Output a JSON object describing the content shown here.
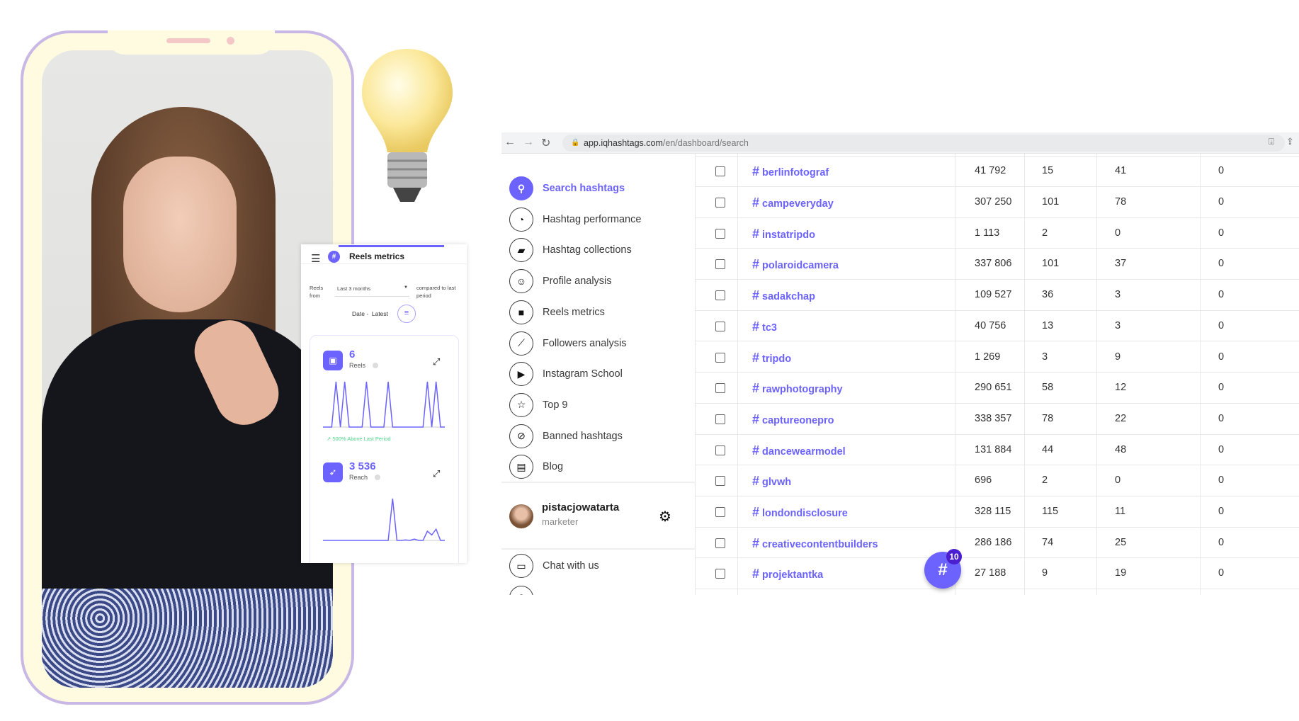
{
  "colors": {
    "accent": "#6c63ff",
    "positive": "#4cd38a",
    "phone_frame": "#c9b8e6"
  },
  "browser": {
    "url_host": "app.iqhashtags.com",
    "url_path": "/en/dashboard/search",
    "icons": [
      "back-arrow-icon",
      "forward-arrow-icon",
      "reload-icon",
      "lock-icon",
      "install-icon",
      "share-icon"
    ]
  },
  "sidebar": {
    "items": [
      {
        "label": "Search hashtags",
        "icon": "search-icon",
        "active": true
      },
      {
        "label": "Hashtag performance",
        "icon": "gauge-icon"
      },
      {
        "label": "Hashtag collections",
        "icon": "folder-star-icon"
      },
      {
        "label": "Profile analysis",
        "icon": "face-icon"
      },
      {
        "label": "Reels metrics",
        "icon": "video-camera-icon"
      },
      {
        "label": "Followers analysis",
        "icon": "trend-icon"
      },
      {
        "label": "Instagram School",
        "icon": "play-chat-icon"
      },
      {
        "label": "Top 9",
        "icon": "star-icon"
      },
      {
        "label": "Banned hashtags",
        "icon": "ban-icon"
      },
      {
        "label": "Blog",
        "icon": "document-icon"
      }
    ],
    "user": {
      "name": "pistacjowatarta",
      "role": "marketer"
    },
    "chat_label": "Chat with us"
  },
  "table": {
    "rows": [
      {
        "tag": "berlinfotograf",
        "c1": "41 792",
        "c2": "15",
        "c3": "41",
        "c4": "0"
      },
      {
        "tag": "campeveryday",
        "c1": "307 250",
        "c2": "101",
        "c3": "78",
        "c4": "0"
      },
      {
        "tag": "instatripdo",
        "c1": "1 113",
        "c2": "2",
        "c3": "0",
        "c4": "0"
      },
      {
        "tag": "polaroidcamera",
        "c1": "337 806",
        "c2": "101",
        "c3": "37",
        "c4": "0"
      },
      {
        "tag": "sadakchap",
        "c1": "109 527",
        "c2": "36",
        "c3": "3",
        "c4": "0"
      },
      {
        "tag": "tc3",
        "c1": "40 756",
        "c2": "13",
        "c3": "3",
        "c4": "0"
      },
      {
        "tag": "tripdo",
        "c1": "1 269",
        "c2": "3",
        "c3": "9",
        "c4": "0"
      },
      {
        "tag": "rawphotography",
        "c1": "290 651",
        "c2": "58",
        "c3": "12",
        "c4": "0"
      },
      {
        "tag": "captureonepro",
        "c1": "338 357",
        "c2": "78",
        "c3": "22",
        "c4": "0"
      },
      {
        "tag": "dancewearmodel",
        "c1": "131 884",
        "c2": "44",
        "c3": "48",
        "c4": "0"
      },
      {
        "tag": "glvwh",
        "c1": "696",
        "c2": "2",
        "c3": "0",
        "c4": "0"
      },
      {
        "tag": "londondisclosure",
        "c1": "328 115",
        "c2": "115",
        "c3": "11",
        "c4": "0"
      },
      {
        "tag": "creativecontentbuilders",
        "c1": "286 186",
        "c2": "74",
        "c3": "25",
        "c4": "0"
      },
      {
        "tag": "projektantka",
        "c1": "27 188",
        "c2": "9",
        "c3": "19",
        "c4": "0"
      }
    ]
  },
  "fab": {
    "symbol": "#",
    "badge": "10"
  },
  "reels_panel": {
    "title": "Reels metrics",
    "from_label": "Reels from",
    "period": "Last 3 months",
    "compare_label": "compared to last period",
    "sort_label": "Date -  Latest",
    "reels": {
      "value": "6",
      "label": "Reels",
      "change": "500%  Above Last Period",
      "series": [
        0,
        0,
        0,
        1,
        0,
        1,
        0,
        0,
        0,
        0,
        1,
        0,
        0,
        0,
        0,
        1,
        0,
        0,
        0,
        0,
        0,
        0,
        0,
        0,
        1,
        0,
        1,
        0,
        0
      ]
    },
    "reach": {
      "value": "3 536",
      "label": "Reach",
      "series": [
        0,
        0,
        0,
        0,
        0,
        0,
        0,
        0,
        0,
        0,
        0,
        0,
        0,
        0,
        0,
        0,
        1,
        0,
        0,
        0.01,
        0,
        0.03,
        0,
        0,
        0.22,
        0.13,
        0.27,
        0,
        0
      ]
    }
  }
}
